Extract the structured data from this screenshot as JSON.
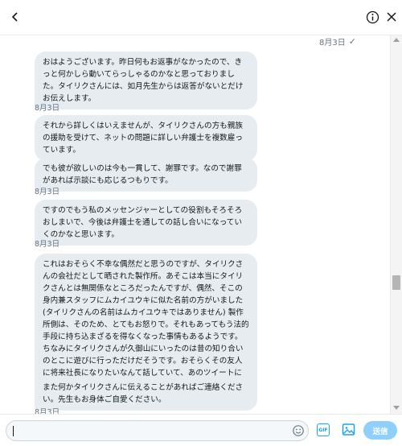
{
  "header": {
    "back_icon": "chevron-left-icon",
    "info_icon": "info-icon",
    "close_icon": "close-icon"
  },
  "conversation": {
    "top_timestamp": "8月3日",
    "top_status_icon": "check-icon",
    "messages": [
      {
        "text": "おはようございます。昨日何もお返事がなかったので、きっと何かしら動いてらっしゃるのかなと思っておりました。タイリクさんには、如月先生からは返答がないとだけお伝えします。",
        "timestamp": "8月3日"
      },
      {
        "text": "それから詳しくはいえませんが、タイリクさんの方も親族の援助を受けて、ネットの問題に詳しい弁護士を複数雇っています。",
        "timestamp": ""
      },
      {
        "text": "でも彼が欲しいのは今も一貫して、謝罪です。なので謝罪があれば示談にも応じるつもりです。",
        "timestamp": "8月3日"
      },
      {
        "text": "ですのでもう私のメッセンジャーとしての役割もそろそろおしまいで、今後は弁護士を通しての話し合いになっていくのかなと思います。",
        "timestamp": "8月3日"
      },
      {
        "text": "これはおそらく不幸な偶然だと思うのですが、タイリクさんの会社だとして晒された製作所。あそこは本当にタイリクさんとは無関係なところだったんですが、偶然、そこの身内兼スタッフにムカイユウキに似た名前の方がいました(タイリクさんの名前はムカイユウキではありません) 製作所側は、そのため、とてもお怒りで。それもあってもう法的手段に持ち込まざるを得なくなった事情もあるようです。ちなみにタイリクさんが久御山にいったのは昔の知り合いのとこに遊びに行っただけだそうです。おそらくその友人に将来社長になりたいなんて話していて、あのツイートになったんじゃないかと思います。",
        "timestamp": ""
      },
      {
        "text": "また何かタイリクさんに伝えることがあればご連絡ください。先生もお身体ご自愛ください。",
        "timestamp": "8月3日"
      }
    ]
  },
  "composer": {
    "emoji_icon": "emoji-icon",
    "gif_label": "GIF",
    "media_icon": "image-icon",
    "send_label": "送信"
  },
  "colors": {
    "accent": "#1da1f2",
    "send_disabled": "#8ed0f9",
    "bubble": "#e6ecf0"
  }
}
